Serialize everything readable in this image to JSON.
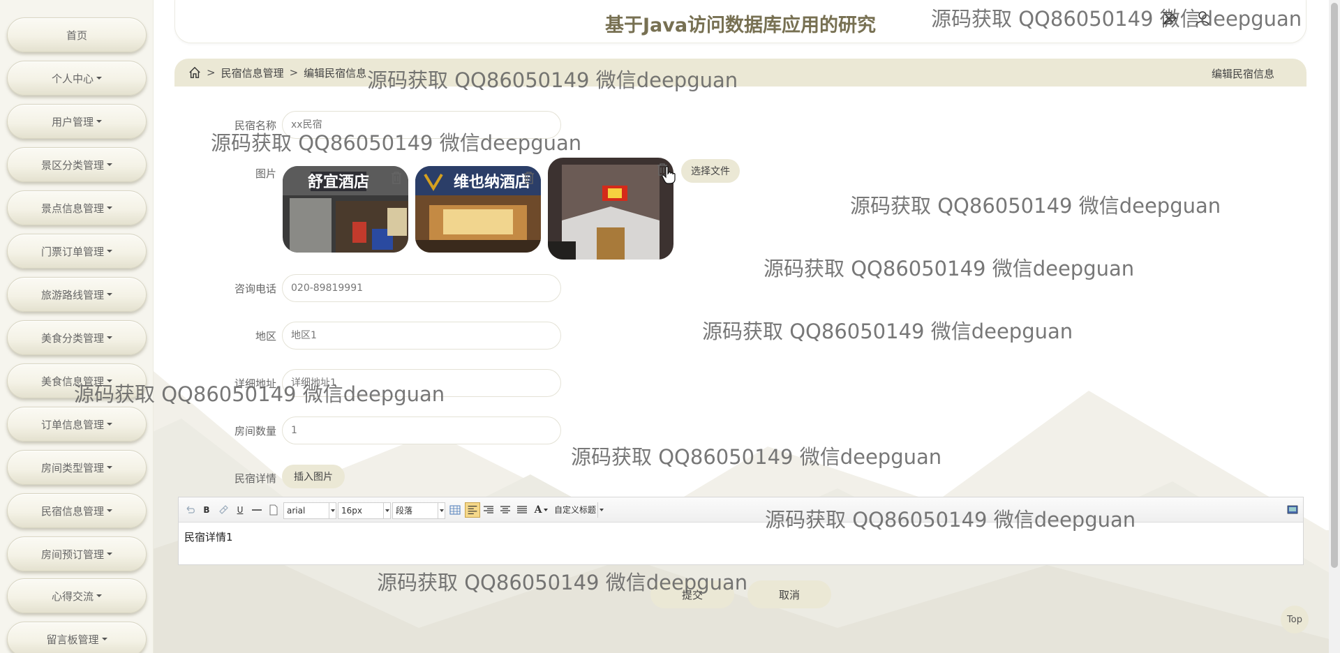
{
  "app": {
    "title": "基于Java访问数据库应用的研究"
  },
  "sidebar": {
    "items": [
      {
        "label": "首页",
        "dropdown": false
      },
      {
        "label": "个人中心",
        "dropdown": true
      },
      {
        "label": "用户管理",
        "dropdown": true
      },
      {
        "label": "景区分类管理",
        "dropdown": true
      },
      {
        "label": "景点信息管理",
        "dropdown": true
      },
      {
        "label": "门票订单管理",
        "dropdown": true
      },
      {
        "label": "旅游路线管理",
        "dropdown": true
      },
      {
        "label": "美食分类管理",
        "dropdown": true
      },
      {
        "label": "美食信息管理",
        "dropdown": true
      },
      {
        "label": "订单信息管理",
        "dropdown": true
      },
      {
        "label": "房间类型管理",
        "dropdown": true
      },
      {
        "label": "民宿信息管理",
        "dropdown": true
      },
      {
        "label": "房间预订管理",
        "dropdown": true
      },
      {
        "label": "心得交流",
        "dropdown": true
      },
      {
        "label": "留言板管理",
        "dropdown": true
      }
    ]
  },
  "breadcrumb": {
    "level1": "民宿信息管理",
    "level2": "编辑民宿信息",
    "right": "编辑民宿信息"
  },
  "form": {
    "name": {
      "label": "民宿名称",
      "value": "xx民宿"
    },
    "images": {
      "label": "图片",
      "choose_file": "选择文件",
      "thumbs": [
        "舒宜酒店",
        "维也纳酒店",
        ""
      ]
    },
    "phone": {
      "label": "咨询电话",
      "value": "020-89819991"
    },
    "region": {
      "label": "地区",
      "value": "地区1"
    },
    "address": {
      "label": "详细地址",
      "value": "详细地址1"
    },
    "rooms": {
      "label": "房间数量",
      "value": "1"
    },
    "details": {
      "label": "民宿详情",
      "insert_image": "插入图片"
    }
  },
  "editor": {
    "toolbar": {
      "bold": "B",
      "underline": "U",
      "font_family": "arial",
      "font_size": "16px",
      "paragraph": "段落",
      "font_color": "A",
      "custom_title": "自定义标题"
    },
    "content": "民宿详情1"
  },
  "actions": {
    "submit": "提交",
    "cancel": "取消"
  },
  "back_to_top": "Top",
  "watermark": "源码获取 QQ86050149 微信deepguan"
}
